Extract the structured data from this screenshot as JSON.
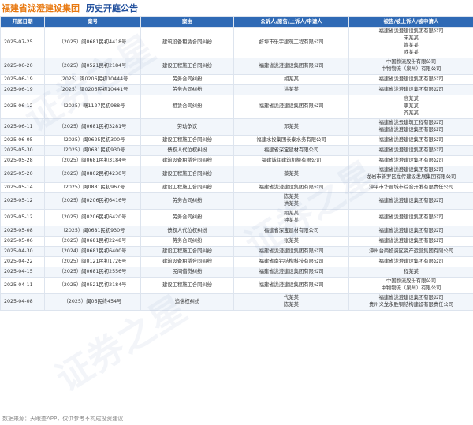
{
  "header": {
    "company": "福建省泷澄建设集团",
    "subtitle": "历史开庭公告"
  },
  "columns": [
    "开庭日期",
    "案号",
    "案由",
    "公诉人/原告/上诉人/申请人",
    "被告/被上诉人/被申请人"
  ],
  "rows": [
    {
      "date": "2025-07-25",
      "case_no": "（2025）闽0681民初4418号",
      "cause": "建筑设备租赁合同纠纷",
      "plaintiff": [
        "蚌埠市乐宇建筑工程有限公司"
      ],
      "defendant": [
        "福建省泷澄建设集团有限公司",
        "宋某某",
        "管某某",
        "欧某某"
      ]
    },
    {
      "date": "2025-06-20",
      "case_no": "（2025）闽0521民初2184号",
      "cause": "建设工程施工合同纠纷",
      "plaintiff": [
        "福建省泷澄建设集团有限公司"
      ],
      "defendant": [
        "中国物流股份有限公司",
        "中物物流（泉州）有限公司"
      ]
    },
    {
      "date": "2025-06-19",
      "case_no": "（2025）闽0206民初10444号",
      "cause": "劳务合同纠纷",
      "plaintiff": [
        "胡某某"
      ],
      "defendant": [
        "福建省泷澄建设集团有限公司"
      ]
    },
    {
      "date": "2025-06-19",
      "case_no": "（2025）闽0206民初10441号",
      "cause": "劳务合同纠纷",
      "plaintiff": [
        "洪某某"
      ],
      "defendant": [
        "福建省泷澄建设集团有限公司"
      ]
    },
    {
      "date": "2025-06-12",
      "case_no": "（2025）赣1127民初988号",
      "cause": "租赁合同纠纷",
      "plaintiff": [
        "福建省泷澄建设集团有限公司"
      ],
      "defendant": [
        "高某某",
        "李某某",
        "齐某某"
      ]
    },
    {
      "date": "2025-06-11",
      "case_no": "（2025）闽0681民初3281号",
      "cause": "劳动争议",
      "plaintiff": [
        "邓某某"
      ],
      "defendant": [
        "福建省泷云建筑工程有限公司",
        "福建省泷澄建设集团有限公司"
      ]
    },
    {
      "date": "2025-06-05",
      "case_no": "（2025）闽0625民初300号",
      "cause": "建设工程施工合同纠纷",
      "plaintiff": [
        "福建水投集团长泰水务有限公司"
      ],
      "defendant": [
        "福建省泷澄建设集团有限公司"
      ]
    },
    {
      "date": "2025-05-30",
      "case_no": "（2025）闽0681民初930号",
      "cause": "债权人代位权纠纷",
      "plaintiff": [
        "福建省深宝建材有限公司"
      ],
      "defendant": [
        "福建省泷澄建设集团有限公司"
      ]
    },
    {
      "date": "2025-05-28",
      "case_no": "（2025）闽0681民初3184号",
      "cause": "建筑设备租赁合同纠纷",
      "plaintiff": [
        "福建诚润建筑机械有限公司"
      ],
      "defendant": [
        "福建省泷澄建设集团有限公司"
      ]
    },
    {
      "date": "2025-05-20",
      "case_no": "（2025）闽0802民初4230号",
      "cause": "建设工程施工合同纠纷",
      "plaintiff": [
        "蔡某某"
      ],
      "defendant": [
        "福建省泷澄建设集团有限公司",
        "龙岩市新罗区龙传建设发展集团有限公司"
      ]
    },
    {
      "date": "2025-05-14",
      "case_no": "（2025）闽0881民初967号",
      "cause": "建设工程施工合同纠纷",
      "plaintiff": [
        "福建省泷澄建设集团有限公司"
      ],
      "defendant": [
        "漳平市华晋城市综合开发有限责任公司"
      ]
    },
    {
      "date": "2025-05-12",
      "case_no": "（2025）闽0206民初6416号",
      "cause": "劳务合同纠纷",
      "plaintiff": [
        "陈某某",
        "洪某某"
      ],
      "defendant": [
        "福建省泷澄建设集团有限公司"
      ]
    },
    {
      "date": "2025-05-12",
      "case_no": "（2025）闽0206民初6420号",
      "cause": "劳务合同纠纷",
      "plaintiff": [
        "胡某某",
        "钟某某"
      ],
      "defendant": [
        "福建省泷澄建设集团有限公司"
      ]
    },
    {
      "date": "2025-05-08",
      "case_no": "（2025）闽0681民初930号",
      "cause": "债权人代位权纠纷",
      "plaintiff": [
        "福建省深宝建材有限公司"
      ],
      "defendant": [
        "福建省泷澄建设集团有限公司"
      ]
    },
    {
      "date": "2025-05-06",
      "case_no": "（2025）闽0681民初2248号",
      "cause": "劳务合同纠纷",
      "plaintiff": [
        "张某某"
      ],
      "defendant": [
        "福建省泷澄建设集团有限公司"
      ]
    },
    {
      "date": "2025-04-30",
      "case_no": "（2024）闽0681民初6400号",
      "cause": "建设工程施工合同纠纷",
      "plaintiff": [
        "福建省泷澄建设集团有限公司"
      ],
      "defendant": [
        "漳州台商投资区资产运营集团有限公司"
      ]
    },
    {
      "date": "2025-04-22",
      "case_no": "（2025）闽0121民初1726号",
      "cause": "建筑设备租赁合同纠纷",
      "plaintiff": [
        "福建省南铝结构科技有限公司"
      ],
      "defendant": [
        "福建省泷澄建设集团有限公司"
      ]
    },
    {
      "date": "2025-04-15",
      "case_no": "（2025）闽0681民初2556号",
      "cause": "民间借贷纠纷",
      "plaintiff": [
        "福建省泷澄建设集团有限公司"
      ],
      "defendant": [
        "程某某"
      ]
    },
    {
      "date": "2025-04-11",
      "case_no": "（2025）闽0521民初2184号",
      "cause": "建设工程施工合同纠纷",
      "plaintiff": [
        "福建省泷澄建设集团有限公司"
      ],
      "defendant": [
        "中国物流股份有限公司",
        "中物物流（泉州）有限公司"
      ]
    },
    {
      "date": "2025-04-08",
      "case_no": "（2025）闽06民终454号",
      "cause": "追偿权纠纷",
      "plaintiff": [
        "代某某",
        "陈某某"
      ],
      "defendant": [
        "福建省泷澄建设集团有限公司",
        "贵州义龙永胜钢结构建设有限责任公司"
      ]
    }
  ],
  "footer": "数据来源：天眼查APP，仅供参考不构成投资建议",
  "watermark": [
    "证券之星",
    "证券之星",
    "证券之星"
  ]
}
